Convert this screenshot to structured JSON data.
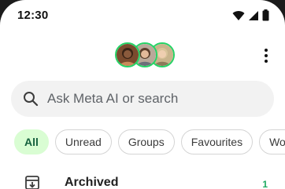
{
  "status_bar": {
    "time": "12:30",
    "icons": [
      "wifi-icon",
      "signal-icon",
      "battery-icon"
    ]
  },
  "header": {
    "avatars": [
      "avatar-1",
      "avatar-2",
      "avatar-3"
    ],
    "more_icon": "more-vert-icon"
  },
  "search": {
    "placeholder": "Ask Meta AI or search",
    "icon": "search-icon"
  },
  "filters": {
    "items": [
      {
        "label": "All",
        "active": true
      },
      {
        "label": "Unread",
        "active": false
      },
      {
        "label": "Groups",
        "active": false
      },
      {
        "label": "Favourites",
        "active": false
      },
      {
        "label": "Work",
        "active": false
      }
    ]
  },
  "archived": {
    "label": "Archived",
    "count": "1",
    "icon": "archive-icon"
  },
  "colors": {
    "accent": "#25d366",
    "chip_active_bg": "#d9fdd3",
    "chip_active_text": "#15603e",
    "count_text": "#1daa61"
  }
}
